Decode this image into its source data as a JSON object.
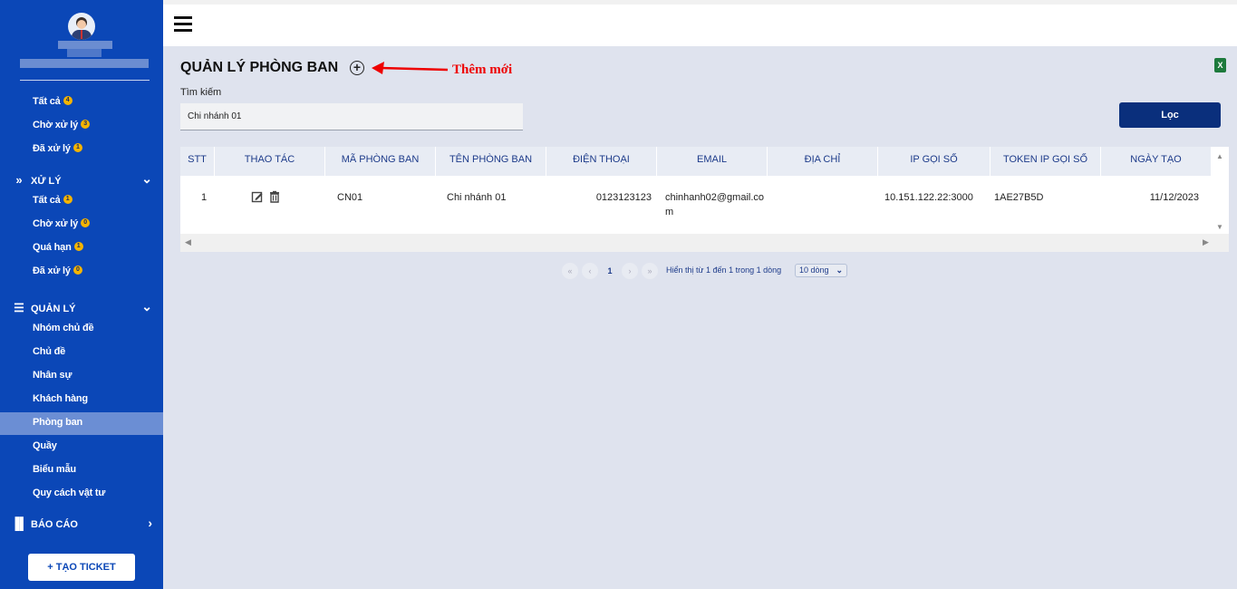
{
  "sidebar": {
    "top_items": [
      {
        "label": "Tất cả",
        "badge": "4"
      },
      {
        "label": "Chờ xử lý",
        "badge": "3"
      },
      {
        "label": "Đã xử lý",
        "badge": "1"
      }
    ],
    "sections": {
      "xu_ly": {
        "label": "XỬ LÝ",
        "items": [
          {
            "label": "Tất cả",
            "badge": "1"
          },
          {
            "label": "Chờ xử lý",
            "badge": "0"
          },
          {
            "label": "Quá hạn",
            "badge": "1"
          },
          {
            "label": "Đã xử lý",
            "badge": "0"
          }
        ]
      },
      "quan_ly": {
        "label": "QUẢN LÝ",
        "items": [
          {
            "label": "Nhóm chủ đề"
          },
          {
            "label": "Chủ đề"
          },
          {
            "label": "Nhân sự"
          },
          {
            "label": "Khách hàng"
          },
          {
            "label": "Phòng ban"
          },
          {
            "label": "Quầy"
          },
          {
            "label": "Biểu mẫu"
          },
          {
            "label": "Quy cách vật tư"
          }
        ]
      },
      "bao_cao": {
        "label": "BÁO CÁO"
      }
    },
    "create_ticket": "+ TẠO TICKET",
    "accent": "#0b47b7",
    "active_bg": "#6b8ed4"
  },
  "main": {
    "title": "QUẢN LÝ PHÒNG BAN",
    "annotation": "Thêm mới",
    "excel_icon": "X",
    "search": {
      "label": "Tìm kiếm",
      "value": "Chi nhánh 01"
    },
    "filter_button": "Lọc",
    "table": {
      "headers": [
        "STT",
        "THAO TÁC",
        "MÃ PHÒNG BAN",
        "TÊN PHÒNG BAN",
        "ĐIỆN THOẠI",
        "EMAIL",
        "ĐỊA CHỈ",
        "IP GỌI SỐ",
        "TOKEN IP GỌI SỐ",
        "NGÀY TẠO"
      ],
      "rows": [
        {
          "stt": "1",
          "ma": "CN01",
          "ten": "Chi nhánh 01",
          "dien_thoai": "0123123123",
          "email_line1": "chinhanh02@gmail.co",
          "email_line2": "m",
          "dia_chi": "",
          "ip": "10.151.122.22:3000",
          "token": "1AE27B5D",
          "ngay_tao": "11/12/2023"
        }
      ]
    },
    "pagination": {
      "first": "«",
      "prev": "‹",
      "current": "1",
      "next": "›",
      "last": "»",
      "info": "Hiển thị từ 1 đến 1 trong 1 dòng",
      "page_size": "10 dòng"
    }
  }
}
